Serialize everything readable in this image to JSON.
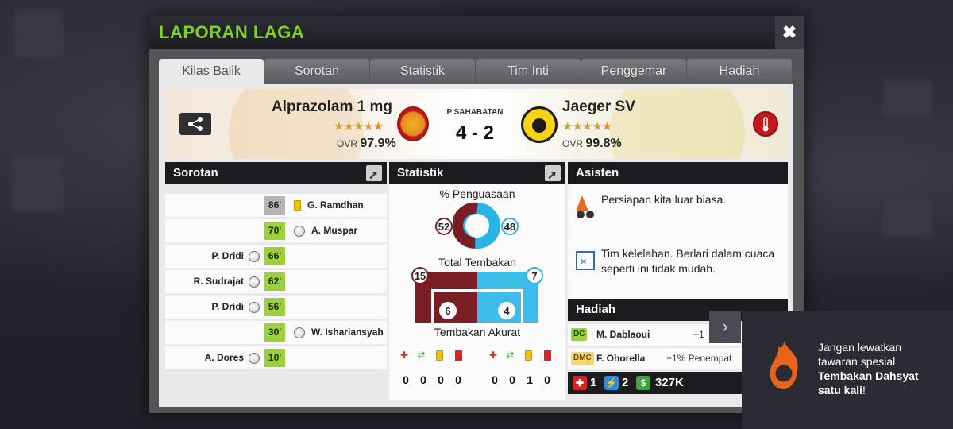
{
  "modal": {
    "title": "LAPORAN LAGA",
    "close_label": "✖"
  },
  "tabs": [
    {
      "label": "Kilas Balik",
      "active": true
    },
    {
      "label": "Sorotan",
      "active": false
    },
    {
      "label": "Statistik",
      "active": false
    },
    {
      "label": "Tim Inti",
      "active": false
    },
    {
      "label": "Penggemar",
      "active": false
    },
    {
      "label": "Hadiah",
      "active": false
    }
  ],
  "match": {
    "home_team": "Alprazolam 1 mg",
    "away_team": "Jaeger SV",
    "match_type": "P'SAHABATAN",
    "score": "4 - 2",
    "home_ovr_label": "OVR",
    "home_ovr": "97.9%",
    "away_ovr_label": "OVR",
    "away_ovr": "99.8%",
    "home_stars": "★★★★",
    "home_star_extra": "★",
    "away_stars": "★★★★",
    "away_star_extra": "★"
  },
  "sorotan": {
    "header": "Sorotan",
    "events": [
      {
        "minute": "86'",
        "kind": "card",
        "side": "away",
        "player": "G. Ramdhan"
      },
      {
        "minute": "70'",
        "kind": "goal",
        "side": "away",
        "player": "A. Muspar"
      },
      {
        "minute": "66'",
        "kind": "goal",
        "side": "home",
        "player": "P. Dridi"
      },
      {
        "minute": "62'",
        "kind": "goal",
        "side": "home",
        "player": "R. Sudrajat"
      },
      {
        "minute": "56'",
        "kind": "goal",
        "side": "home",
        "player": "P. Dridi"
      },
      {
        "minute": "30'",
        "kind": "goal",
        "side": "away",
        "player": "W. Ishariansyah"
      },
      {
        "minute": "10'",
        "kind": "goal",
        "side": "home",
        "player": "A. Dores"
      }
    ]
  },
  "statistik": {
    "header": "Statistik",
    "possession_label": "% Penguasaan",
    "possession_home": "52",
    "possession_away": "48",
    "shots_label": "Total Tembakan",
    "shots_home": "15",
    "shots_away": "7",
    "on_target_label": "Tembakan Akurat",
    "on_target_home": "6",
    "on_target_away": "4",
    "home_counts": [
      "0",
      "0",
      "0",
      "0"
    ],
    "away_counts": [
      "0",
      "0",
      "1",
      "0"
    ]
  },
  "asisten": {
    "header": "Asisten",
    "messages": [
      "Persiapan kita luar biasa.",
      "Tim kelelahan. Berlari dalam cuaca seperti ini tidak mudah."
    ]
  },
  "hadiah": {
    "header": "Hadiah",
    "rows": [
      {
        "pos": "DC",
        "name": "M. Dablaoui",
        "value": "+1"
      },
      {
        "pos": "DMC",
        "name": "F. Ohorella",
        "value": "+1% Penempat"
      }
    ],
    "totals": {
      "medical": "1",
      "energy": "2",
      "money": "327K"
    }
  },
  "promo": {
    "line1": "Jangan lewatkan",
    "line2": "tawaran spesial",
    "highlight": "Tembakan Dahsyat",
    "line4": "satu kali",
    "line4_suffix": "!"
  },
  "colors": {
    "title_green": "#7ed321",
    "home_maroon": "#7a1e24",
    "away_blue": "#2bb3e6",
    "goal_green": "#9bd13a"
  }
}
